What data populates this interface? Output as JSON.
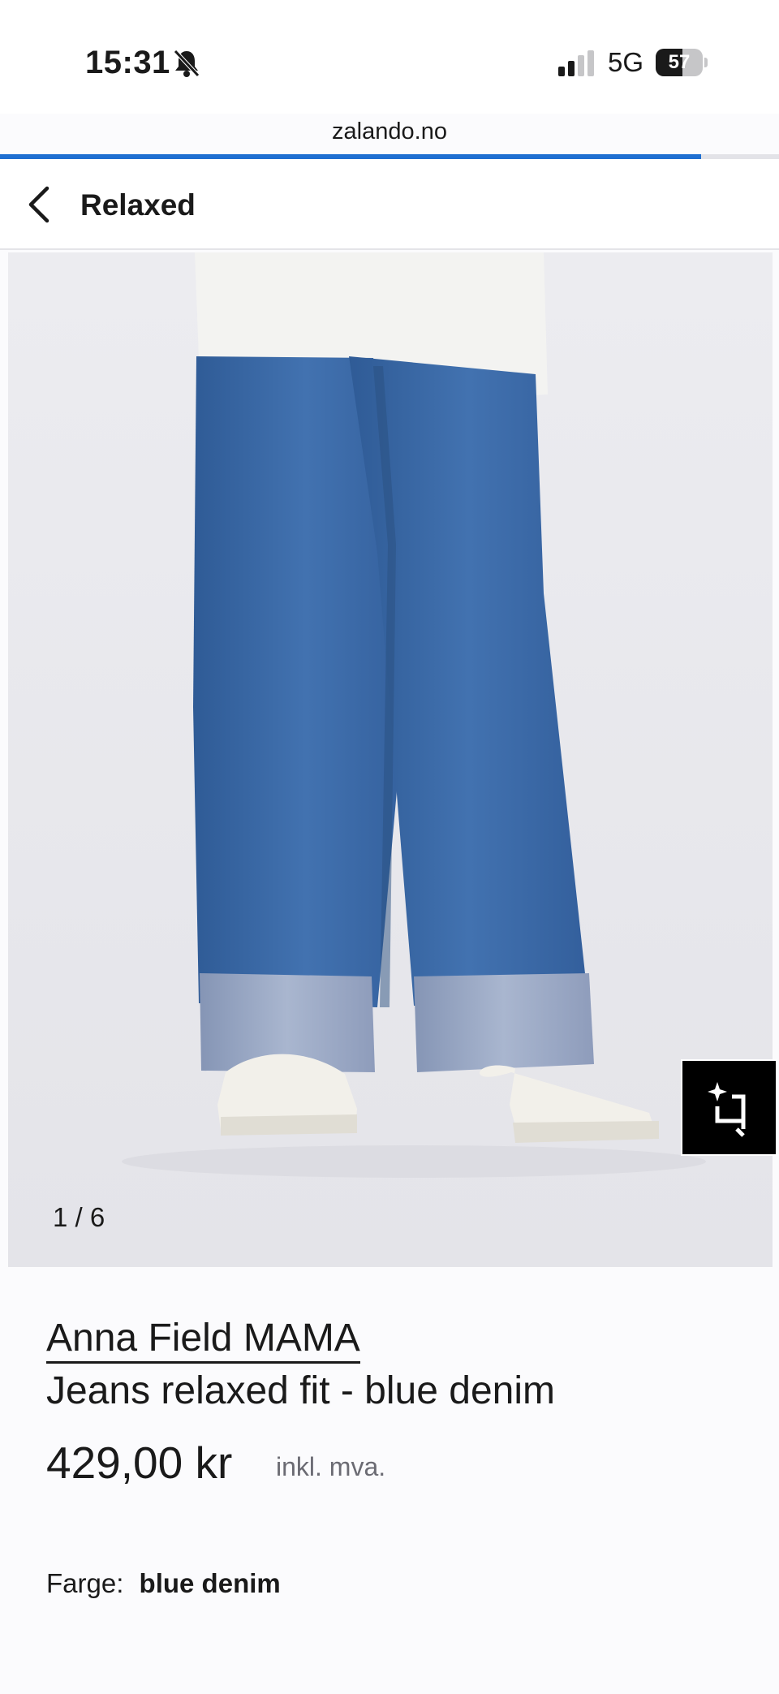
{
  "status_bar": {
    "time": "15:31",
    "network": "5G",
    "battery_percent": "57",
    "battery_level": 0.57
  },
  "browser": {
    "url": "zalando.no",
    "load_progress": 0.9
  },
  "header": {
    "title": "Relaxed"
  },
  "gallery": {
    "counter": "1 / 6",
    "background": "#e9e9ee",
    "denim_color": "#3d6aa6"
  },
  "product": {
    "brand": "Anna Field MAMA",
    "name": "Jeans relaxed fit - blue denim",
    "price": "429,00 kr",
    "vat_note": "inkl. mva.",
    "color_label": "Farge:",
    "color_value": "blue denim"
  },
  "colors": {
    "accent": "#1f6fd1",
    "text": "#1a1a1a",
    "muted": "#6b6b73"
  }
}
